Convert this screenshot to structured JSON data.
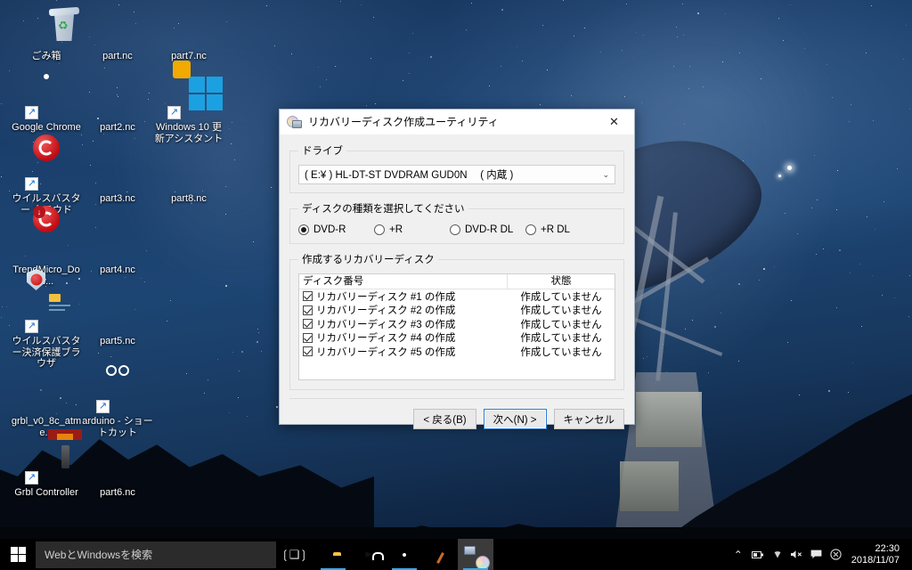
{
  "desktop": {
    "icons": [
      {
        "label": "ごみ箱",
        "icon": "recycle-bin-icon",
        "name": "desktop-icon-recycle-bin"
      },
      {
        "label": "part.nc",
        "icon": "file-icon",
        "name": "desktop-icon-part-nc"
      },
      {
        "label": "part7.nc",
        "icon": "file-icon",
        "name": "desktop-icon-part7-nc"
      },
      {
        "label": "Google Chrome",
        "icon": "chrome-icon",
        "name": "desktop-icon-google-chrome"
      },
      {
        "label": "part2.nc",
        "icon": "file-icon",
        "name": "desktop-icon-part2-nc"
      },
      {
        "label": "Windows 10 更新アシスタント",
        "icon": "windows-update-icon",
        "name": "desktop-icon-windows-update-assistant"
      },
      {
        "label": "ウイルスバスター クラウド",
        "icon": "trendmicro-icon",
        "name": "desktop-icon-virusbuster-cloud"
      },
      {
        "label": "part3.nc",
        "icon": "file-icon",
        "name": "desktop-icon-part3-nc"
      },
      {
        "label": "part8.nc",
        "icon": "file-icon",
        "name": "desktop-icon-part8-nc"
      },
      {
        "label": "TrendMicro_Dow...",
        "icon": "trendmicro-download-icon",
        "name": "desktop-icon-trendmicro-download"
      },
      {
        "label": "part4.nc",
        "icon": "file-icon",
        "name": "desktop-icon-part4-nc"
      },
      {
        "label": "ウイルスバスター決済保護ブラウザ",
        "icon": "secure-browser-icon",
        "name": "desktop-icon-secure-payment-browser"
      },
      {
        "label": "part5.nc",
        "icon": "file-icon",
        "name": "desktop-icon-part5-nc"
      },
      {
        "label": "grbl_v0_8c_atme...",
        "icon": "file-icon",
        "name": "desktop-icon-grbl-hex"
      },
      {
        "label": "arduino - ショートカット",
        "icon": "arduino-icon",
        "name": "desktop-icon-arduino-shortcut"
      },
      {
        "label": "Grbl Controller",
        "icon": "grbl-controller-icon",
        "name": "desktop-icon-grbl-controller"
      },
      {
        "label": "part6.nc",
        "icon": "file-icon",
        "name": "desktop-icon-part6-nc"
      }
    ]
  },
  "dialog": {
    "title": "リカバリーディスク作成ユーティリティ",
    "title_icon": "recovery-disc-icon",
    "close_label": "✕",
    "drive_group_label": "ドライブ",
    "drive_value": "( E:¥ ) HL-DT-ST DVDRAM GUD0N　 ( 内蔵 )",
    "drive_chevron": "⌄",
    "disc_type_group_label": "ディスクの種類を選択してください",
    "disc_types": [
      {
        "label": "DVD-R",
        "selected": true
      },
      {
        "label": "+R",
        "selected": false
      },
      {
        "label": "DVD-R DL",
        "selected": false
      },
      {
        "label": "+R DL",
        "selected": false
      }
    ],
    "list_group_label": "作成するリカバリーディスク",
    "columns": [
      "ディスク番号",
      "状態"
    ],
    "rows": [
      {
        "checked": true,
        "disc": "リカバリーディスク #1 の作成",
        "status": "作成していません"
      },
      {
        "checked": true,
        "disc": "リカバリーディスク #2 の作成",
        "status": "作成していません"
      },
      {
        "checked": true,
        "disc": "リカバリーディスク #3 の作成",
        "status": "作成していません"
      },
      {
        "checked": true,
        "disc": "リカバリーディスク #4 の作成",
        "status": "作成していません"
      },
      {
        "checked": true,
        "disc": "リカバリーディスク #5 の作成",
        "status": "作成していません"
      }
    ],
    "buttons": {
      "back": "< 戻る(B)",
      "next": "次へ(N) >",
      "cancel": "キャンセル"
    },
    "accent": "#2a7bd4"
  },
  "taskbar": {
    "start_label": "start-button",
    "search_placeholder": "WebとWindowsを検索",
    "task_view": "❲❑❳",
    "apps": [
      {
        "name": "taskbar-app-file-explorer",
        "glyph": "folder-icon",
        "active": false,
        "running": true
      },
      {
        "name": "taskbar-app-store",
        "glyph": "store-icon",
        "active": false,
        "running": false
      },
      {
        "name": "taskbar-app-chrome",
        "glyph": "chrome-icon",
        "active": false,
        "running": true
      },
      {
        "name": "taskbar-app-paint",
        "glyph": "paint-icon",
        "active": false,
        "running": false
      },
      {
        "name": "taskbar-app-recovery-utility",
        "glyph": "recovery-disc-icon",
        "active": true,
        "running": true
      }
    ],
    "tray": [
      {
        "name": "show-hidden-icons-chevron",
        "glyph": "⌃"
      },
      {
        "name": "battery-icon",
        "glyph": "🔋"
      },
      {
        "name": "wifi-icon",
        "glyph": "◗"
      },
      {
        "name": "volume-mute-icon",
        "glyph": "🔇"
      },
      {
        "name": "action-center-icon",
        "glyph": "🗨"
      },
      {
        "name": "notification-badge-icon",
        "glyph": "⊗"
      }
    ],
    "clock_time": "22:30",
    "clock_date": "2018/11/07"
  }
}
